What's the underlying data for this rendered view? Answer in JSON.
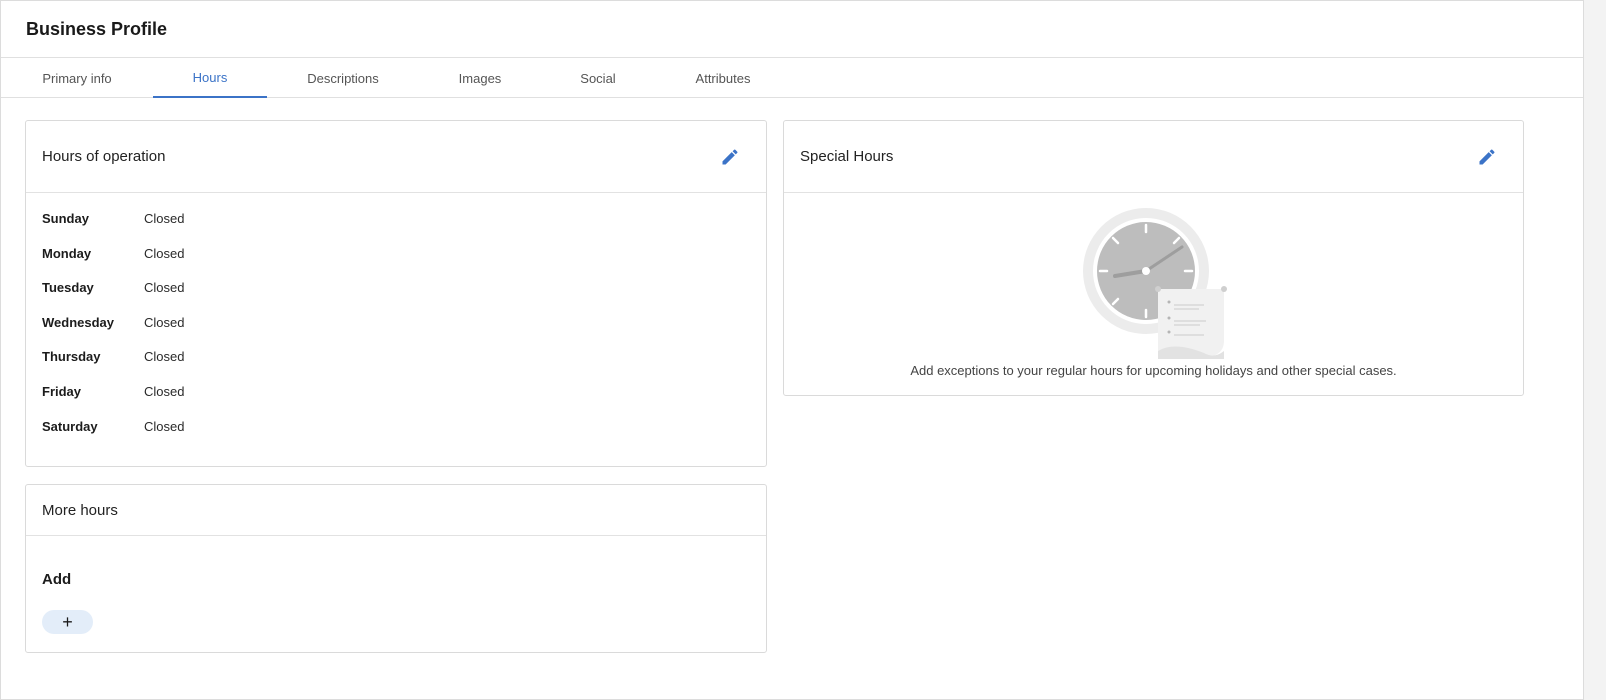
{
  "page": {
    "title": "Business Profile"
  },
  "tabs": [
    {
      "label": "Primary info",
      "active": false
    },
    {
      "label": "Hours",
      "active": true
    },
    {
      "label": "Descriptions",
      "active": false
    },
    {
      "label": "Images",
      "active": false
    },
    {
      "label": "Social",
      "active": false
    },
    {
      "label": "Attributes",
      "active": false
    }
  ],
  "hours_of_operation": {
    "title": "Hours of operation",
    "edit_icon": "pencil-icon",
    "rows": [
      {
        "day": "Sunday",
        "value": "Closed"
      },
      {
        "day": "Monday",
        "value": "Closed"
      },
      {
        "day": "Tuesday",
        "value": "Closed"
      },
      {
        "day": "Wednesday",
        "value": "Closed"
      },
      {
        "day": "Thursday",
        "value": "Closed"
      },
      {
        "day": "Friday",
        "value": "Closed"
      },
      {
        "day": "Saturday",
        "value": "Closed"
      }
    ]
  },
  "more_hours": {
    "title": "More hours",
    "add_label": "Add",
    "add_button": "+"
  },
  "special_hours": {
    "title": "Special Hours",
    "edit_icon": "pencil-icon",
    "illustration": "clock-calendar-icon",
    "empty_message": "Add exceptions to your regular hours for upcoming holidays and other special cases."
  },
  "colors": {
    "accent": "#3b73c7",
    "add_button_bg": "#e3edf9"
  }
}
